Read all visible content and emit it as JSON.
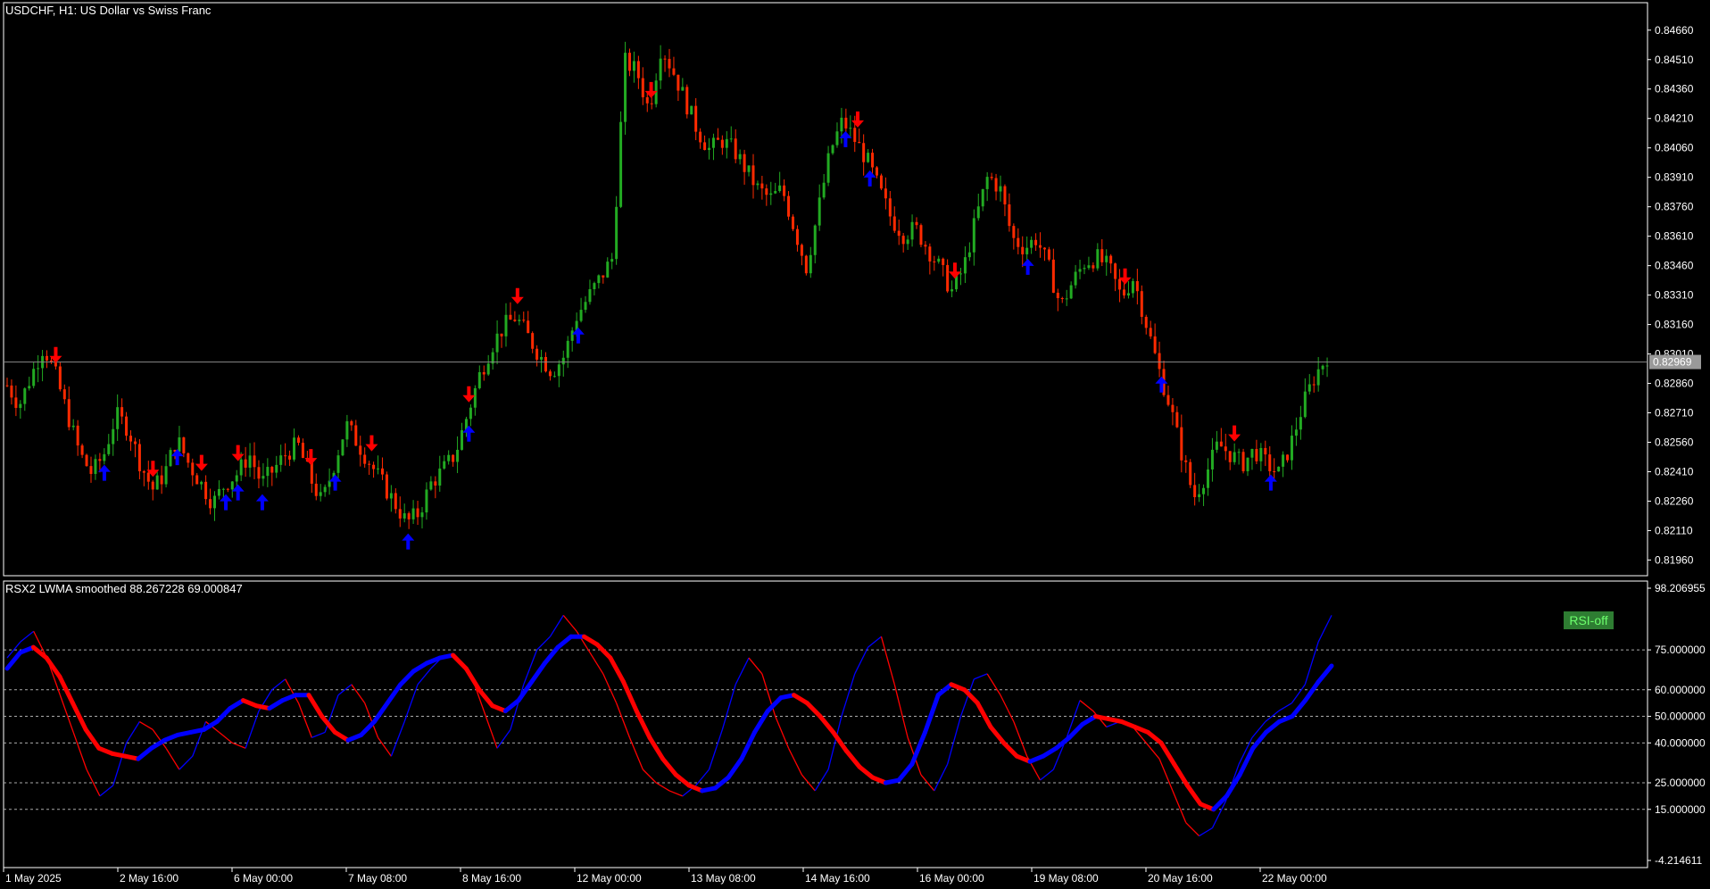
{
  "window": {
    "main_title": "USDCHF, H1:  US Dollar vs Swiss Franc",
    "indicator_title": "RSX2 LWMA smoothed  88.267228 69.000847",
    "current_price_label": "0.82969",
    "rsi_state_label": "RSI-off"
  },
  "colors": {
    "background": "#000000",
    "frame": "#ffffff",
    "bull": "#22aa22",
    "bear": "#ff2a00",
    "arrow_up": "#0000ff",
    "arrow_down": "#ff0000",
    "rsx_slow": "#ff0000",
    "rsx_fast": "#0000ff",
    "rsi_badge_bg": "#2e7d32",
    "rsi_badge_text": "#6cff6c"
  },
  "chart_data": [
    {
      "type": "candlestick",
      "title": "USDCHF, H1:  US Dollar vs Swiss Franc",
      "ylim": [
        0.8188,
        0.848
      ],
      "y_ticks": [
        "0.84660",
        "0.84510",
        "0.84360",
        "0.84210",
        "0.84060",
        "0.83910",
        "0.83760",
        "0.83610",
        "0.83460",
        "0.83310",
        "0.83160",
        "0.83010",
        "0.82860",
        "0.82710",
        "0.82560",
        "0.82410",
        "0.82260",
        "0.82110",
        "0.81960"
      ],
      "current_price": 0.82969,
      "series": [
        {
          "name": "close_path",
          "values": [
            0.8285,
            0.8275,
            0.829,
            0.8305,
            0.829,
            0.827,
            0.825,
            0.824,
            0.825,
            0.827,
            0.8263,
            0.8245,
            0.8232,
            0.824,
            0.8258,
            0.8245,
            0.8235,
            0.8225,
            0.8235,
            0.824,
            0.825,
            0.8235,
            0.8242,
            0.825,
            0.8255,
            0.8238,
            0.8225,
            0.8245,
            0.8265,
            0.8255,
            0.8245,
            0.8235,
            0.8225,
            0.8215,
            0.822,
            0.8235,
            0.8242,
            0.825,
            0.827,
            0.829,
            0.8305,
            0.8315,
            0.832,
            0.831,
            0.83,
            0.8292,
            0.83,
            0.832,
            0.833,
            0.834,
            0.835,
            0.845,
            0.8445,
            0.8425,
            0.8458,
            0.8445,
            0.843,
            0.8415,
            0.8405,
            0.841,
            0.8405,
            0.8395,
            0.8385,
            0.838,
            0.8385,
            0.8365,
            0.8345,
            0.8375,
            0.8405,
            0.842,
            0.841,
            0.84,
            0.8385,
            0.837,
            0.8362,
            0.8365,
            0.8355,
            0.8345,
            0.8333,
            0.8345,
            0.837,
            0.8392,
            0.8385,
            0.836,
            0.8355,
            0.836,
            0.8345,
            0.8325,
            0.8338,
            0.8348,
            0.835,
            0.8345,
            0.833,
            0.834,
            0.8318,
            0.8295,
            0.8275,
            0.825,
            0.8228,
            0.824,
            0.8255,
            0.825,
            0.8245,
            0.8252,
            0.8245,
            0.824,
            0.8255,
            0.8275,
            0.829,
            0.83
          ]
        },
        {
          "name": "arrows_up",
          "values": [
            8,
            14,
            18,
            19,
            21,
            27,
            33,
            38,
            47,
            69,
            71,
            84,
            95,
            104
          ]
        },
        {
          "name": "arrows_down",
          "values": [
            4,
            12,
            16,
            19,
            25,
            30,
            38,
            42,
            53,
            70,
            78,
            92,
            101
          ]
        }
      ]
    },
    {
      "type": "line",
      "title": "RSX2 LWMA smoothed  88.267228 69.000847",
      "ylim": [
        -4.214611,
        98.206955
      ],
      "y_ticks": [
        "98.206955",
        "75.000000",
        "60.000000",
        "50.000000",
        "40.000000",
        "25.000000",
        "15.000000",
        "-4.214611"
      ],
      "levels": [
        75,
        60,
        50,
        40,
        25,
        15
      ],
      "series": [
        {
          "name": "",
          "values": [
            68,
            74,
            76,
            72,
            65,
            55,
            45,
            38,
            36,
            35,
            34,
            38,
            41,
            43,
            44,
            45,
            48,
            53,
            56,
            54,
            53,
            56,
            58,
            58,
            50,
            44,
            41,
            43,
            48,
            55,
            62,
            67,
            70,
            72,
            73,
            68,
            60,
            54,
            52,
            56,
            63,
            70,
            76,
            80,
            80,
            77,
            72,
            63,
            52,
            42,
            34,
            28,
            24,
            22,
            23,
            27,
            34,
            44,
            52,
            57,
            58,
            55,
            50,
            44,
            37,
            31,
            27,
            25,
            26,
            32,
            44,
            58,
            62,
            60,
            55,
            46,
            40,
            35,
            33,
            35,
            38,
            42,
            47,
            50,
            49,
            48,
            46,
            44,
            40,
            32,
            24,
            17,
            15,
            20,
            28,
            38,
            44,
            48,
            50,
            56,
            63,
            69
          ]
        },
        {
          "name": "",
          "values": [
            72,
            78,
            82,
            72,
            58,
            44,
            30,
            20,
            24,
            40,
            48,
            45,
            38,
            30,
            35,
            48,
            44,
            40,
            38,
            52,
            60,
            64,
            55,
            42,
            44,
            58,
            62,
            55,
            42,
            35,
            48,
            62,
            68,
            73,
            72,
            66,
            52,
            38,
            45,
            62,
            75,
            80,
            88,
            82,
            74,
            66,
            55,
            42,
            30,
            25,
            22,
            20,
            24,
            30,
            45,
            62,
            72,
            66,
            50,
            38,
            28,
            22,
            30,
            50,
            66,
            76,
            80,
            62,
            42,
            28,
            22,
            32,
            50,
            64,
            66,
            58,
            48,
            35,
            26,
            30,
            42,
            56,
            52,
            46,
            48,
            46,
            40,
            34,
            22,
            10,
            5,
            8,
            18,
            32,
            42,
            48,
            52,
            55,
            62,
            78,
            88
          ]
        }
      ]
    }
  ],
  "x_axis_labels": [
    "1 May 2025",
    "2 May 16:00",
    "6 May 00:00",
    "7 May 08:00",
    "8 May 16:00",
    "12 May 00:00",
    "13 May 08:00",
    "14 May 16:00",
    "16 May 00:00",
    "19 May 08:00",
    "20 May 16:00",
    "22 May 00:00"
  ]
}
